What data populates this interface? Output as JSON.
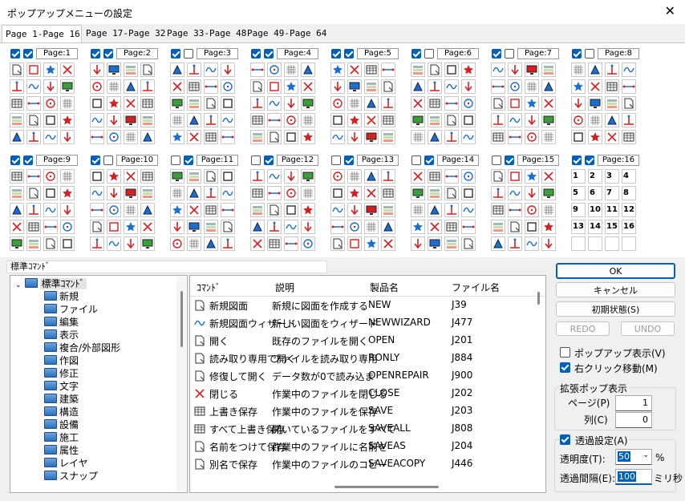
{
  "window": {
    "title": "ポップアップメニューの設定",
    "close_glyph": "✕"
  },
  "tabs": [
    "Page  1-Page 16",
    "Page 17-Page 32",
    "Page 33-Page 48",
    "Page 49-Page 64"
  ],
  "pages": [
    {
      "label": "Page:1",
      "cb1": true,
      "cb2": true
    },
    {
      "label": "Page:2",
      "cb1": true,
      "cb2": true
    },
    {
      "label": "Page:3",
      "cb1": true,
      "cb2": false
    },
    {
      "label": "Page:4",
      "cb1": true,
      "cb2": true
    },
    {
      "label": "Page:5",
      "cb1": true,
      "cb2": true
    },
    {
      "label": "Page:6",
      "cb1": true,
      "cb2": false
    },
    {
      "label": "Page:7",
      "cb1": true,
      "cb2": false
    },
    {
      "label": "Page:8",
      "cb1": true,
      "cb2": false
    },
    {
      "label": "Page:9",
      "cb1": true,
      "cb2": true
    },
    {
      "label": "Page:10",
      "cb1": true,
      "cb2": false
    },
    {
      "label": "Page:11",
      "cb1": false,
      "cb2": true
    },
    {
      "label": "Page:12",
      "cb1": false,
      "cb2": true
    },
    {
      "label": "Page:13",
      "cb1": false,
      "cb2": true
    },
    {
      "label": "Page:14",
      "cb1": false,
      "cb2": true
    },
    {
      "label": "Page:15",
      "cb1": false,
      "cb2": true
    },
    {
      "label": "Page:16",
      "cb1": true,
      "cb2": true
    }
  ],
  "page16_numbers": [
    "1",
    "2",
    "3",
    "4",
    "5",
    "6",
    "7",
    "8",
    "9",
    "10",
    "11",
    "12",
    "13",
    "14",
    "15",
    "16"
  ],
  "command_panel_label": "標準ｺﾏﾝﾄﾞ",
  "tree": {
    "root": "標準ｺﾏﾝﾄﾞ",
    "items": [
      "新規",
      "ファイル",
      "編集",
      "表示",
      "複合/外部図形",
      "作図",
      "修正",
      "文字",
      "建築",
      "構造",
      "設備",
      "施工",
      "属性",
      "レイヤ",
      "スナップ"
    ]
  },
  "list": {
    "headers": [
      "ｺﾏﾝﾄﾞ",
      "説明",
      "製品名",
      "ファイル名"
    ],
    "rows": [
      {
        "cmd": "新規図面",
        "desc": "新規に図面を作成する",
        "prod": "NEW",
        "file": "J39"
      },
      {
        "cmd": "新規図面ウィザード",
        "desc": "新しい図面をウィザード",
        "prod": "NEWWIZARD",
        "file": "J477"
      },
      {
        "cmd": "開く",
        "desc": "既存のファイルを開く",
        "prod": "OPEN",
        "file": "J201"
      },
      {
        "cmd": "読み取り専用で開く",
        "desc": "ファイルを読み取り専用",
        "prod": "RONLY",
        "file": "J884"
      },
      {
        "cmd": "修復して開く",
        "desc": "データ数が0で読み込ま",
        "prod": "OPENREPAIR",
        "file": "J900"
      },
      {
        "cmd": "閉じる",
        "desc": "作業中のファイルを閉じる",
        "prod": "CLOSE",
        "file": "J202"
      },
      {
        "cmd": "上書き保存",
        "desc": "作業中のファイルを保存",
        "prod": "SAVE",
        "file": "J203"
      },
      {
        "cmd": "すべて上書き保存",
        "desc": "開いているファイルをすべて",
        "prod": "SAVEALL",
        "file": "J808"
      },
      {
        "cmd": "名前をつけて保存",
        "desc": "作業中のファイルに名前を",
        "prod": "SAVEAS",
        "file": "J204"
      },
      {
        "cmd": "別名で保存",
        "desc": "作業中のファイルのコピー",
        "prod": "SAVEACOPY",
        "file": "J446"
      }
    ]
  },
  "buttons": {
    "ok": "OK",
    "cancel": "キャンセル",
    "reset": "初期状態(S)",
    "redo": "REDO",
    "undo": "UNDO"
  },
  "options": {
    "popup_show": {
      "label": "ポップアップ表示(V)",
      "checked": false
    },
    "right_click": {
      "label": "右クリック移動(M)",
      "checked": true
    }
  },
  "expand": {
    "title": "拡張ポップ表示",
    "page_label": "ページ(P)",
    "page_value": "1",
    "col_label": "列(C)",
    "col_value": "0"
  },
  "transparency": {
    "title": "透過設定(A)",
    "checked": true,
    "degree_label": "透明度(T):",
    "degree_value": "50",
    "degree_unit": "%",
    "interval_label": "透過間隔(E):",
    "interval_value": "100",
    "interval_unit": "ミリ秒"
  },
  "colors": {
    "accent": "#005fb8",
    "icon_red": "#d42020",
    "icon_blue": "#1a6fd0"
  }
}
